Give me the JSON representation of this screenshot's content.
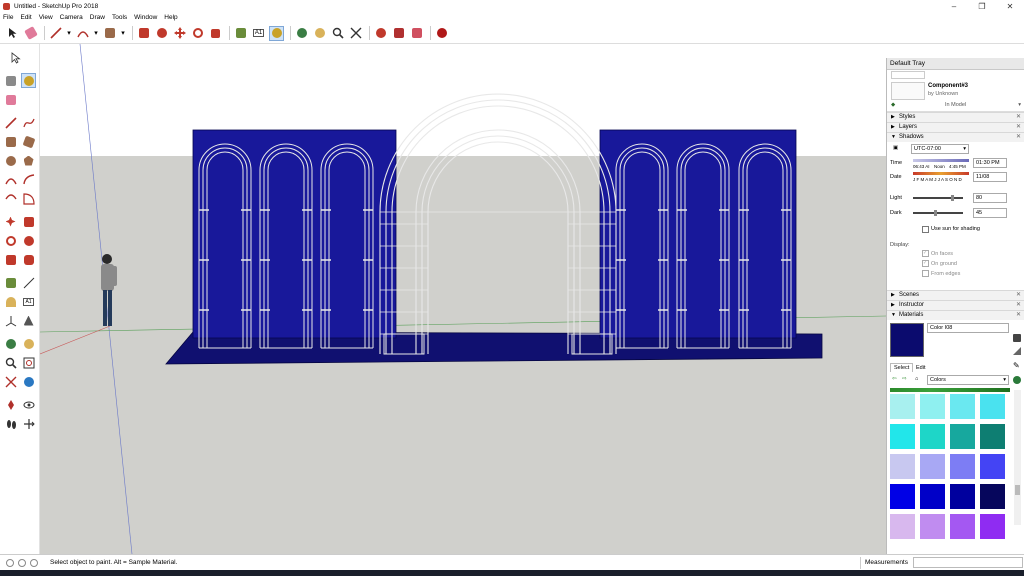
{
  "window": {
    "title": "Untitled - SketchUp Pro 2018",
    "controls": [
      "–",
      "❐",
      "✕"
    ]
  },
  "menu": [
    "File",
    "Edit",
    "View",
    "Camera",
    "Draw",
    "Tools",
    "Window",
    "Help"
  ],
  "toolbar_icons": [
    "select-icon",
    "eraser-icon",
    "line-icon",
    "arc-icon",
    "shape-icon",
    "push-pull-icon",
    "follow-me-icon",
    "move-icon",
    "rotate-icon",
    "scale-icon",
    "tape-icon",
    "text-icon",
    "paint-bucket-icon",
    "orbit-icon",
    "pan-icon",
    "zoom-icon",
    "zoom-extents-icon",
    "warehouse-icon",
    "extension-icon",
    "ruby-icon"
  ],
  "tray": {
    "title": "Default Tray",
    "component": {
      "name": "Component#3",
      "author": "by Unknown",
      "location": "In Model"
    },
    "sections": {
      "styles": "Styles",
      "layers": "Layers",
      "shadows": "Shadows",
      "scenes": "Scenes",
      "instructor": "Instructor",
      "materials": "Materials"
    },
    "shadows": {
      "utc": "UTC-07:00",
      "time_label": "Time",
      "time_start": "06:43 AI",
      "time_noon": "Noon",
      "time_end": "4:45 PM",
      "time_value": "01:30 PM",
      "date_label": "Date",
      "months": "J F M A M J J A S O N D",
      "date_value": "11/08",
      "light_label": "Light",
      "light_value": "80",
      "dark_label": "Dark",
      "dark_value": "45",
      "use_sun": "Use sun for shading",
      "display_label": "Display:",
      "on_faces": "On faces",
      "on_ground": "On ground",
      "from_edges": "From edges"
    },
    "materials": {
      "name": "Color I08",
      "current_color": "#0b0b6e",
      "tab_select": "Select",
      "tab_edit": "Edit",
      "library": "Colors",
      "swatches": [
        "#a8f0ef",
        "#8ff0f0",
        "#6ae8f0",
        "#4ae2ef",
        "#22e6ea",
        "#1ed6c8",
        "#17a89e",
        "#0e7e72",
        "#c8c8f0",
        "#a8a8f4",
        "#7d7df4",
        "#4444f4",
        "#0000e6",
        "#0000c8",
        "#00009e",
        "#06065c",
        "#d8b8ee",
        "#c08cf0",
        "#a458f2",
        "#8f2cf2"
      ]
    }
  },
  "status": {
    "text": "Select object to paint. Alt = Sample Material.",
    "measurements": "Measurements"
  },
  "colors": {
    "sky": "#ffffff",
    "ground": "#d0d0cc",
    "panel": "#18189a",
    "base": "#101070",
    "arch": "#e8e8e8"
  }
}
